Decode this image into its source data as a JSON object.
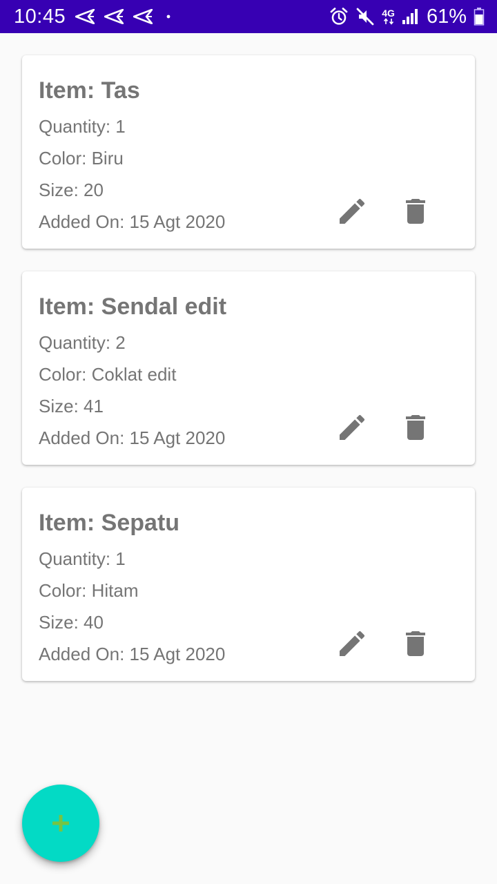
{
  "status_bar": {
    "time": "10:45",
    "network_label": "4G",
    "battery": "61%",
    "color": "#3700b3",
    "icons": [
      "send-icon",
      "send-icon",
      "send-icon",
      "dot-icon",
      "alarm-icon",
      "mute-icon",
      "signal-icon",
      "battery-icon"
    ]
  },
  "items": [
    {
      "title": "Item: Tas",
      "quantity": "Quantity: 1",
      "color": "Color: Biru",
      "size": "Size: 20",
      "added_on": "Added On: 15 Agt 2020"
    },
    {
      "title": "Item: Sendal edit",
      "quantity": "Quantity: 2",
      "color": "Color: Coklat edit",
      "size": "Size: 41",
      "added_on": "Added On: 15 Agt 2020"
    },
    {
      "title": "Item: Sepatu",
      "quantity": "Quantity: 1",
      "color": "Color: Hitam",
      "size": "Size: 40",
      "added_on": "Added On: 15 Agt 2020"
    }
  ],
  "card_actions": {
    "edit_icon": "pencil-icon",
    "delete_icon": "trash-icon",
    "icon_color": "#757575"
  },
  "fab": {
    "icon": "plus-icon",
    "color": "#03dac5",
    "icon_color": "#76c442"
  }
}
